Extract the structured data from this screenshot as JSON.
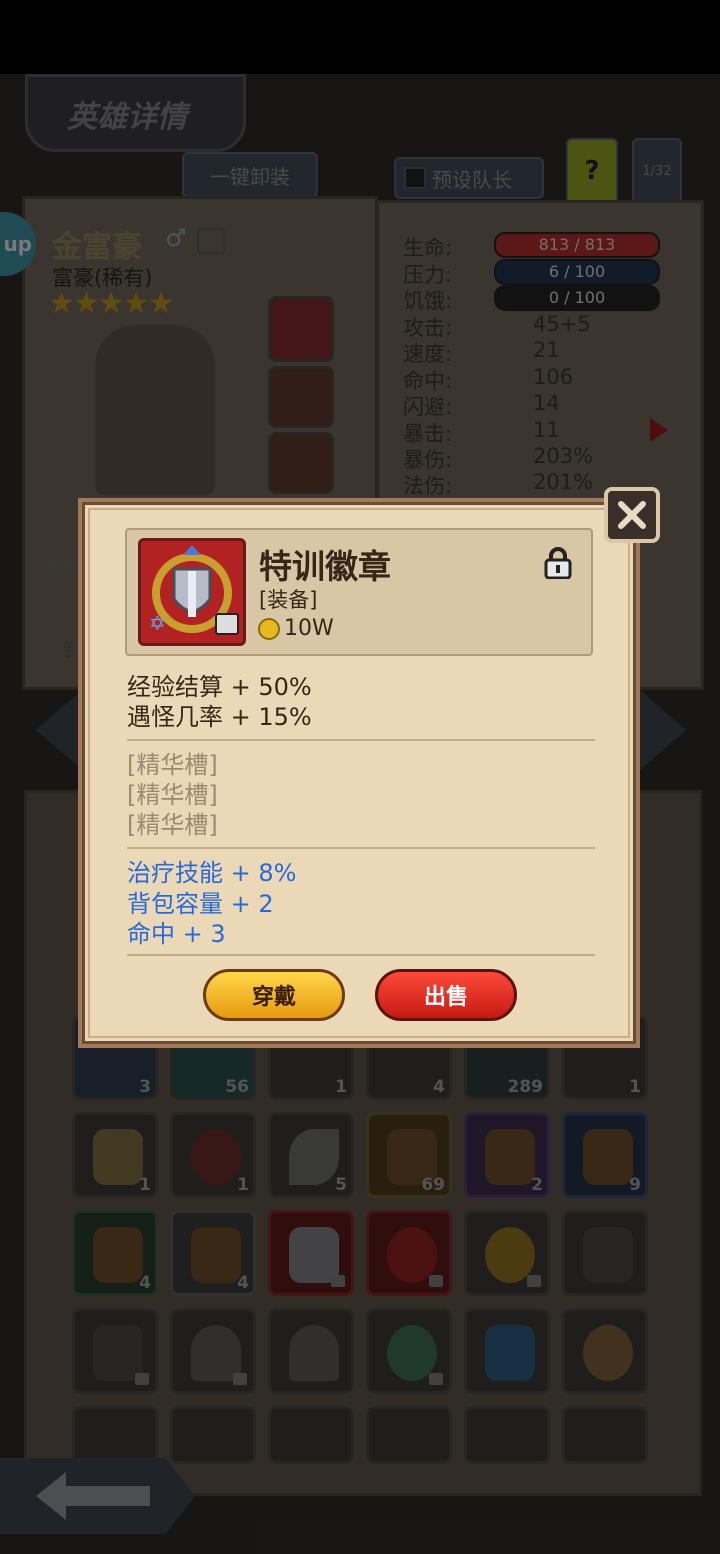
{
  "header": {
    "title": "英雄详情",
    "unequip_all": "一键卸装",
    "preset_leader": "预设队长",
    "help": "?",
    "page_counter": "1/32"
  },
  "hero": {
    "name": "金富豪",
    "class": "富豪(稀有)",
    "stars": 5,
    "side_label": "等",
    "side_label2": "钅",
    "badge": "up"
  },
  "stats": [
    {
      "label": "生命:",
      "value": "813 / 813",
      "bar": "#a82a2a"
    },
    {
      "label": "压力:",
      "value": "6 / 100",
      "bar": "#2a5aa8"
    },
    {
      "label": "饥饿:",
      "value": "0 / 100",
      "bar": "#222222"
    },
    {
      "label": "攻击:",
      "value": "45+5"
    },
    {
      "label": "速度:",
      "value": "21"
    },
    {
      "label": "命中:",
      "value": "106"
    },
    {
      "label": "闪避:",
      "value": "14"
    },
    {
      "label": "暴击:",
      "value": "11"
    },
    {
      "label": "暴伤:",
      "value": "203%"
    },
    {
      "label": "法伤:",
      "value": "201%"
    }
  ],
  "inventory": {
    "counts_row1": [
      "3",
      "56",
      "",
      "1",
      "4",
      "289",
      "1"
    ],
    "row2": [
      "1",
      "1",
      "5",
      "69",
      "2",
      "9"
    ],
    "row3": [
      "4",
      "4",
      "",
      "",
      "",
      ""
    ]
  },
  "modal": {
    "item_name": "特训徽章",
    "item_type": "[装备]",
    "price": "10W",
    "base_stats": [
      "经验结算 + 50%",
      "遇怪几率 + 15%"
    ],
    "essence_slots": [
      "[精华槽]",
      "[精华槽]",
      "[精华槽]"
    ],
    "bonus_stats": [
      "治疗技能 + 8%",
      "背包容量 + 2",
      "命中 + 3"
    ],
    "wear_label": "穿戴",
    "sell_label": "出售",
    "colors": {
      "base_text": "#3b2418",
      "essence_text": "#9a8a72",
      "bonus_text": "#2a6ad8"
    }
  }
}
